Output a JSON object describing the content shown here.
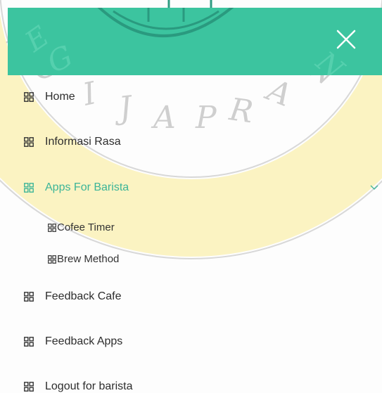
{
  "colors": {
    "header_bg": "#3cc49f",
    "active_text": "#3cb598",
    "text": "#2d2d2d",
    "watermark_yellow": "#fbf3c2"
  },
  "header": {
    "close_icon": "close-icon"
  },
  "menu": {
    "items": [
      {
        "label": "Home",
        "icon": "grid-icon"
      },
      {
        "label": "Informasi Rasa",
        "icon": "grid-icon"
      },
      {
        "label": "Apps For Barista",
        "icon": "grid-icon",
        "active": true,
        "expanded": true
      },
      {
        "label": "Feedback Cafe",
        "icon": "grid-icon"
      },
      {
        "label": "Feedback Apps",
        "icon": "grid-icon"
      },
      {
        "label": "Logout for barista",
        "icon": "grid-icon"
      }
    ],
    "subitems": [
      {
        "label": "Cofee Timer",
        "icon": "grid-icon"
      },
      {
        "label": "Brew Method",
        "icon": "grid-icon"
      }
    ]
  },
  "watermark": {
    "text": "EGIJAPRANA"
  }
}
